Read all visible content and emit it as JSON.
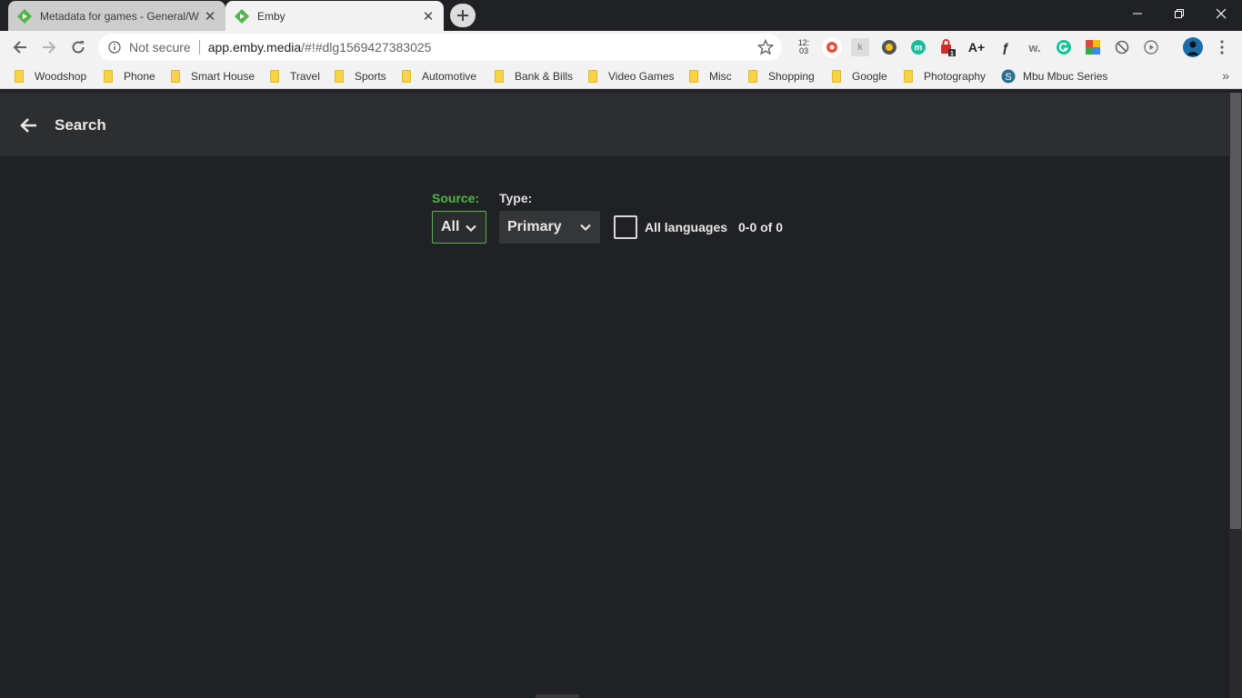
{
  "browser": {
    "tabs": [
      {
        "title": "Metadata for games - General/W",
        "active": false
      },
      {
        "title": "Emby",
        "active": true
      }
    ],
    "omnibox": {
      "security_label": "Not secure",
      "url_domain": "app.emby.media",
      "url_path": "/#!#dlg1569427383025"
    },
    "clock": {
      "line1": "12:",
      "line2": "03"
    },
    "extensions": [
      "clock-icon",
      "ublock-icon",
      "kite-icon",
      "honey-icon",
      "mercury-icon",
      "lastpass-icon",
      "font-size-icon",
      "fetch-icon",
      "writer-icon",
      "grammarly-icon",
      "google-drive-icon",
      "block-icon",
      "play-icon"
    ],
    "extension_badges": {
      "lastpass": "1"
    },
    "bookmarks": [
      "Woodshop",
      "Phone",
      "Smart House",
      "Travel",
      "Sports",
      "Automotive",
      "Bank & Bills",
      "Video Games",
      "Misc",
      "Shopping",
      "Google",
      "Photography",
      "Mbu Mbuc Series"
    ],
    "bookmarks_more": "»"
  },
  "app": {
    "title": "Search",
    "filters": {
      "source_label": "Source:",
      "source_value": "All",
      "type_label": "Type:",
      "type_value": "Primary",
      "all_languages_label": "All languages",
      "all_languages_checked": false,
      "result_count": "0-0 of 0"
    }
  },
  "colors": {
    "accent": "#52b54b",
    "background": "#202124",
    "header": "#2d2e30"
  }
}
